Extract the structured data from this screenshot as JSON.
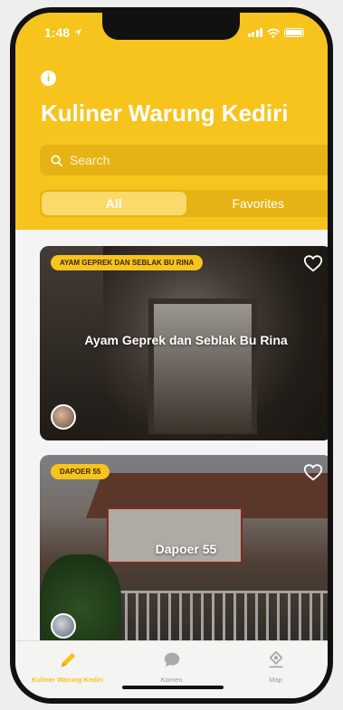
{
  "status_bar": {
    "time": "1:48"
  },
  "header": {
    "title": "Kuliner Warung Kediri",
    "search": {
      "placeholder": "Search",
      "value": ""
    },
    "segments": [
      {
        "label": "All",
        "active": true
      },
      {
        "label": "Favorites",
        "active": false
      }
    ]
  },
  "cards": [
    {
      "tag": "AYAM GEPREK DAN SEBLAK BU RINA",
      "title": "Ayam Geprek dan Seblak Bu Rina",
      "favorite": false
    },
    {
      "tag": "DAPOER 55",
      "title": "Dapoer 55",
      "favorite": false
    }
  ],
  "tab_bar": {
    "tabs": [
      {
        "label": "Kuliner Warung Kediri",
        "icon": "pencil-icon",
        "active": true
      },
      {
        "label": "Komen",
        "icon": "chat-bubble-icon",
        "active": false
      },
      {
        "label": "Map",
        "icon": "map-pin-icon",
        "active": false
      }
    ]
  },
  "colors": {
    "accent": "#f7c31d",
    "inactive": "#999999"
  }
}
